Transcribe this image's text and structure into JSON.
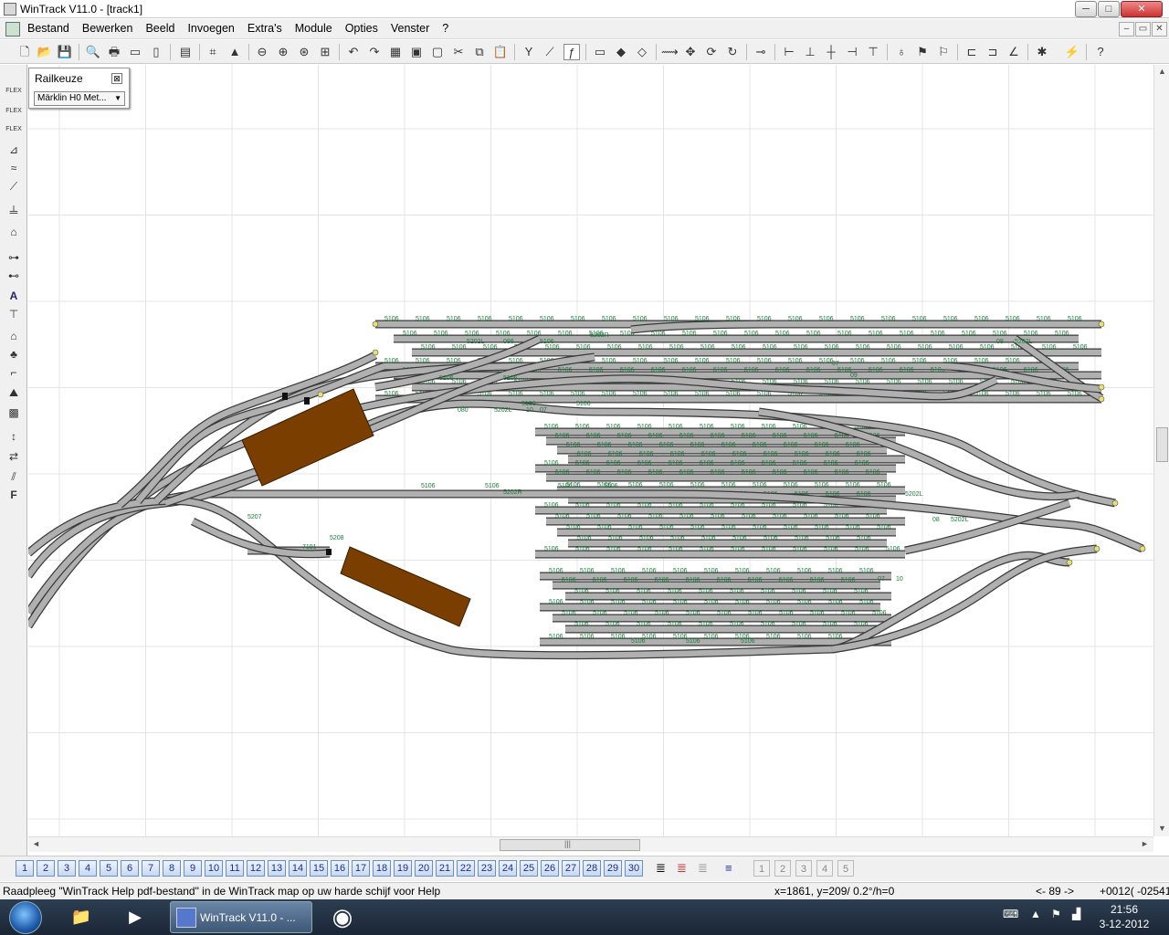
{
  "window": {
    "title": "WinTrack  V11.0 - [track1]",
    "controls": {
      "minimize": "─",
      "maximize": "□",
      "close": "✕"
    }
  },
  "menu": {
    "items": [
      "Bestand",
      "Bewerken",
      "Beeld",
      "Invoegen",
      "Extra's",
      "Module",
      "Opties",
      "Venster",
      "?"
    ],
    "mdi_controls": {
      "minimize": "–",
      "restore": "▭",
      "close": "✕"
    }
  },
  "railpanel": {
    "title": "Railkeuze",
    "close": "⊠",
    "selected": "Märklin H0 Met..."
  },
  "track_labels": {
    "straight": "5106",
    "left_switch": "5202L",
    "right_switch": "5202R",
    "num_08": "08",
    "num_07": "07",
    "num_09": "09",
    "num_10": "10",
    "num_086": "086",
    "num_080": "080",
    "num_5208": "5208",
    "num_7191": "7191",
    "num_5207": "5207"
  },
  "colors": {
    "track": "#b0b0b0",
    "track_edge": "#3a3a3a",
    "label": "#1a7a3a",
    "building": "#7a3e00",
    "grid": "#e4e4e4"
  },
  "scroll": {
    "left": "◄",
    "right": "►",
    "up": "▲",
    "down": "▼",
    "grip": "|||"
  },
  "pages": {
    "numbered": [
      "1",
      "2",
      "3",
      "4",
      "5",
      "6",
      "7",
      "8",
      "9",
      "10",
      "11",
      "12",
      "13",
      "14",
      "15",
      "16",
      "17",
      "18",
      "19",
      "20",
      "21",
      "22",
      "23",
      "24",
      "25",
      "26",
      "27",
      "28",
      "29",
      "30"
    ],
    "extra": [
      "1",
      "2",
      "3",
      "4",
      "5"
    ]
  },
  "status": {
    "help": "Raadpleeg \"WinTrack Help pdf-bestand\" in de WinTrack map op uw harde schijf voor Help",
    "coords": "x=1861, y=209/ 0.2°/h=0",
    "page_indicator": "<- 89 ->",
    "extra": "+0012( -02541"
  },
  "taskbar": {
    "active_app": "WinTrack  V11.0 - ...",
    "time": "21:56",
    "date": "3-12-2012"
  }
}
